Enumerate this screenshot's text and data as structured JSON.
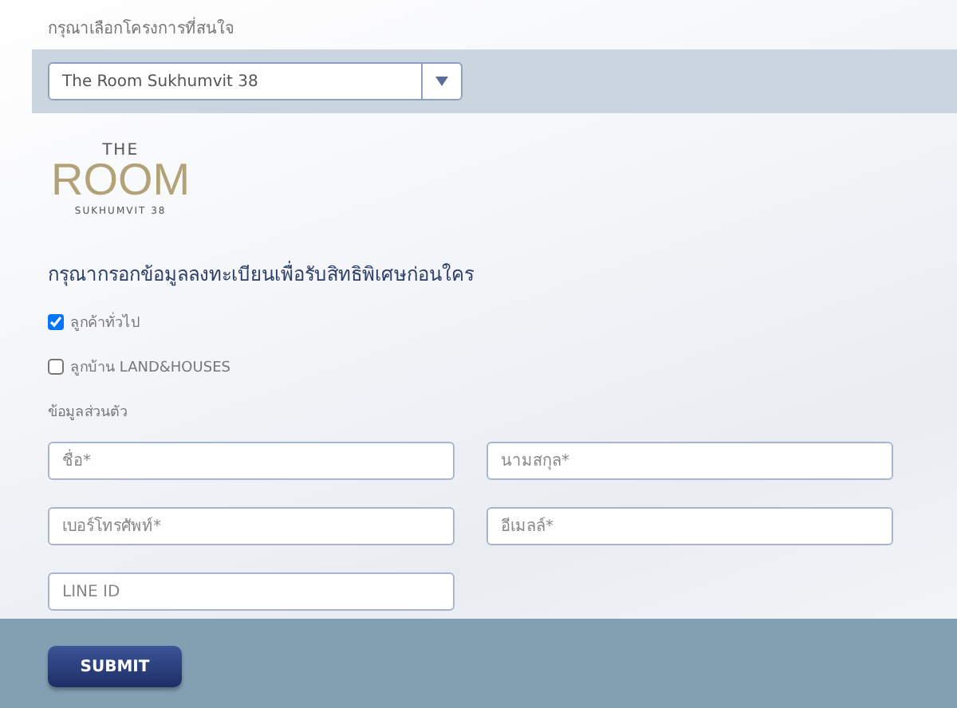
{
  "project_select": {
    "label": "กรุณาเลือกโครงการที่สนใจ",
    "value": "The Room Sukhumvit 38"
  },
  "logo": {
    "top": "THE",
    "main": "ROOM",
    "sub": "SUKHUMVIT 38"
  },
  "heading": "กรุณากรอกข้อมูลลงทะเบียนเพื่อรับสิทธิพิเศษก่อนใคร",
  "customer_types": [
    {
      "label": "ลูกค้าทั่วไป",
      "checked": true
    },
    {
      "label": "ลูกบ้าน LAND&HOUSES",
      "checked": false
    }
  ],
  "section_label": "ข้อมูลส่วนตัว",
  "fields": [
    {
      "placeholder": "ชื่อ*"
    },
    {
      "placeholder": "นามสกุล*"
    },
    {
      "placeholder": "เบอร์โทรศัพท์*"
    },
    {
      "placeholder": "อีเมลล์*"
    },
    {
      "placeholder": "LINE ID"
    }
  ],
  "submit_button": "SUBMIT"
}
